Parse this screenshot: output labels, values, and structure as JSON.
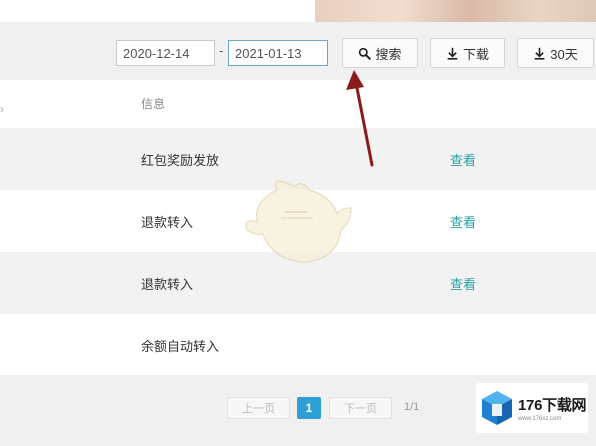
{
  "filters": {
    "start_date": "2020-12-14",
    "end_date": "2021-01-13",
    "date_separator": "-"
  },
  "toolbar": {
    "search_label": "搜索",
    "download_label": "下载",
    "download_30_label": "30天"
  },
  "table": {
    "header_info": "信息",
    "rows": [
      {
        "info": "红包奖励发放",
        "action": "查看"
      },
      {
        "info": "退款转入",
        "action": "查看"
      },
      {
        "info": "退款转入",
        "action": "查看"
      },
      {
        "info": "余额自动转入",
        "action": ""
      }
    ]
  },
  "pagination": {
    "prev_label": "上一页",
    "current_page": "1",
    "next_label": "下一页",
    "page_count": "1/1"
  },
  "watermark": {
    "brand": "176下载网",
    "site": "www.176xz.com"
  },
  "colors": {
    "link": "#2aa0a4",
    "page_active": "#2f9fd6",
    "arrow": "#8b1a1a"
  },
  "icons": {
    "search": "magnifier-icon",
    "download": "download-arrow-icon"
  }
}
